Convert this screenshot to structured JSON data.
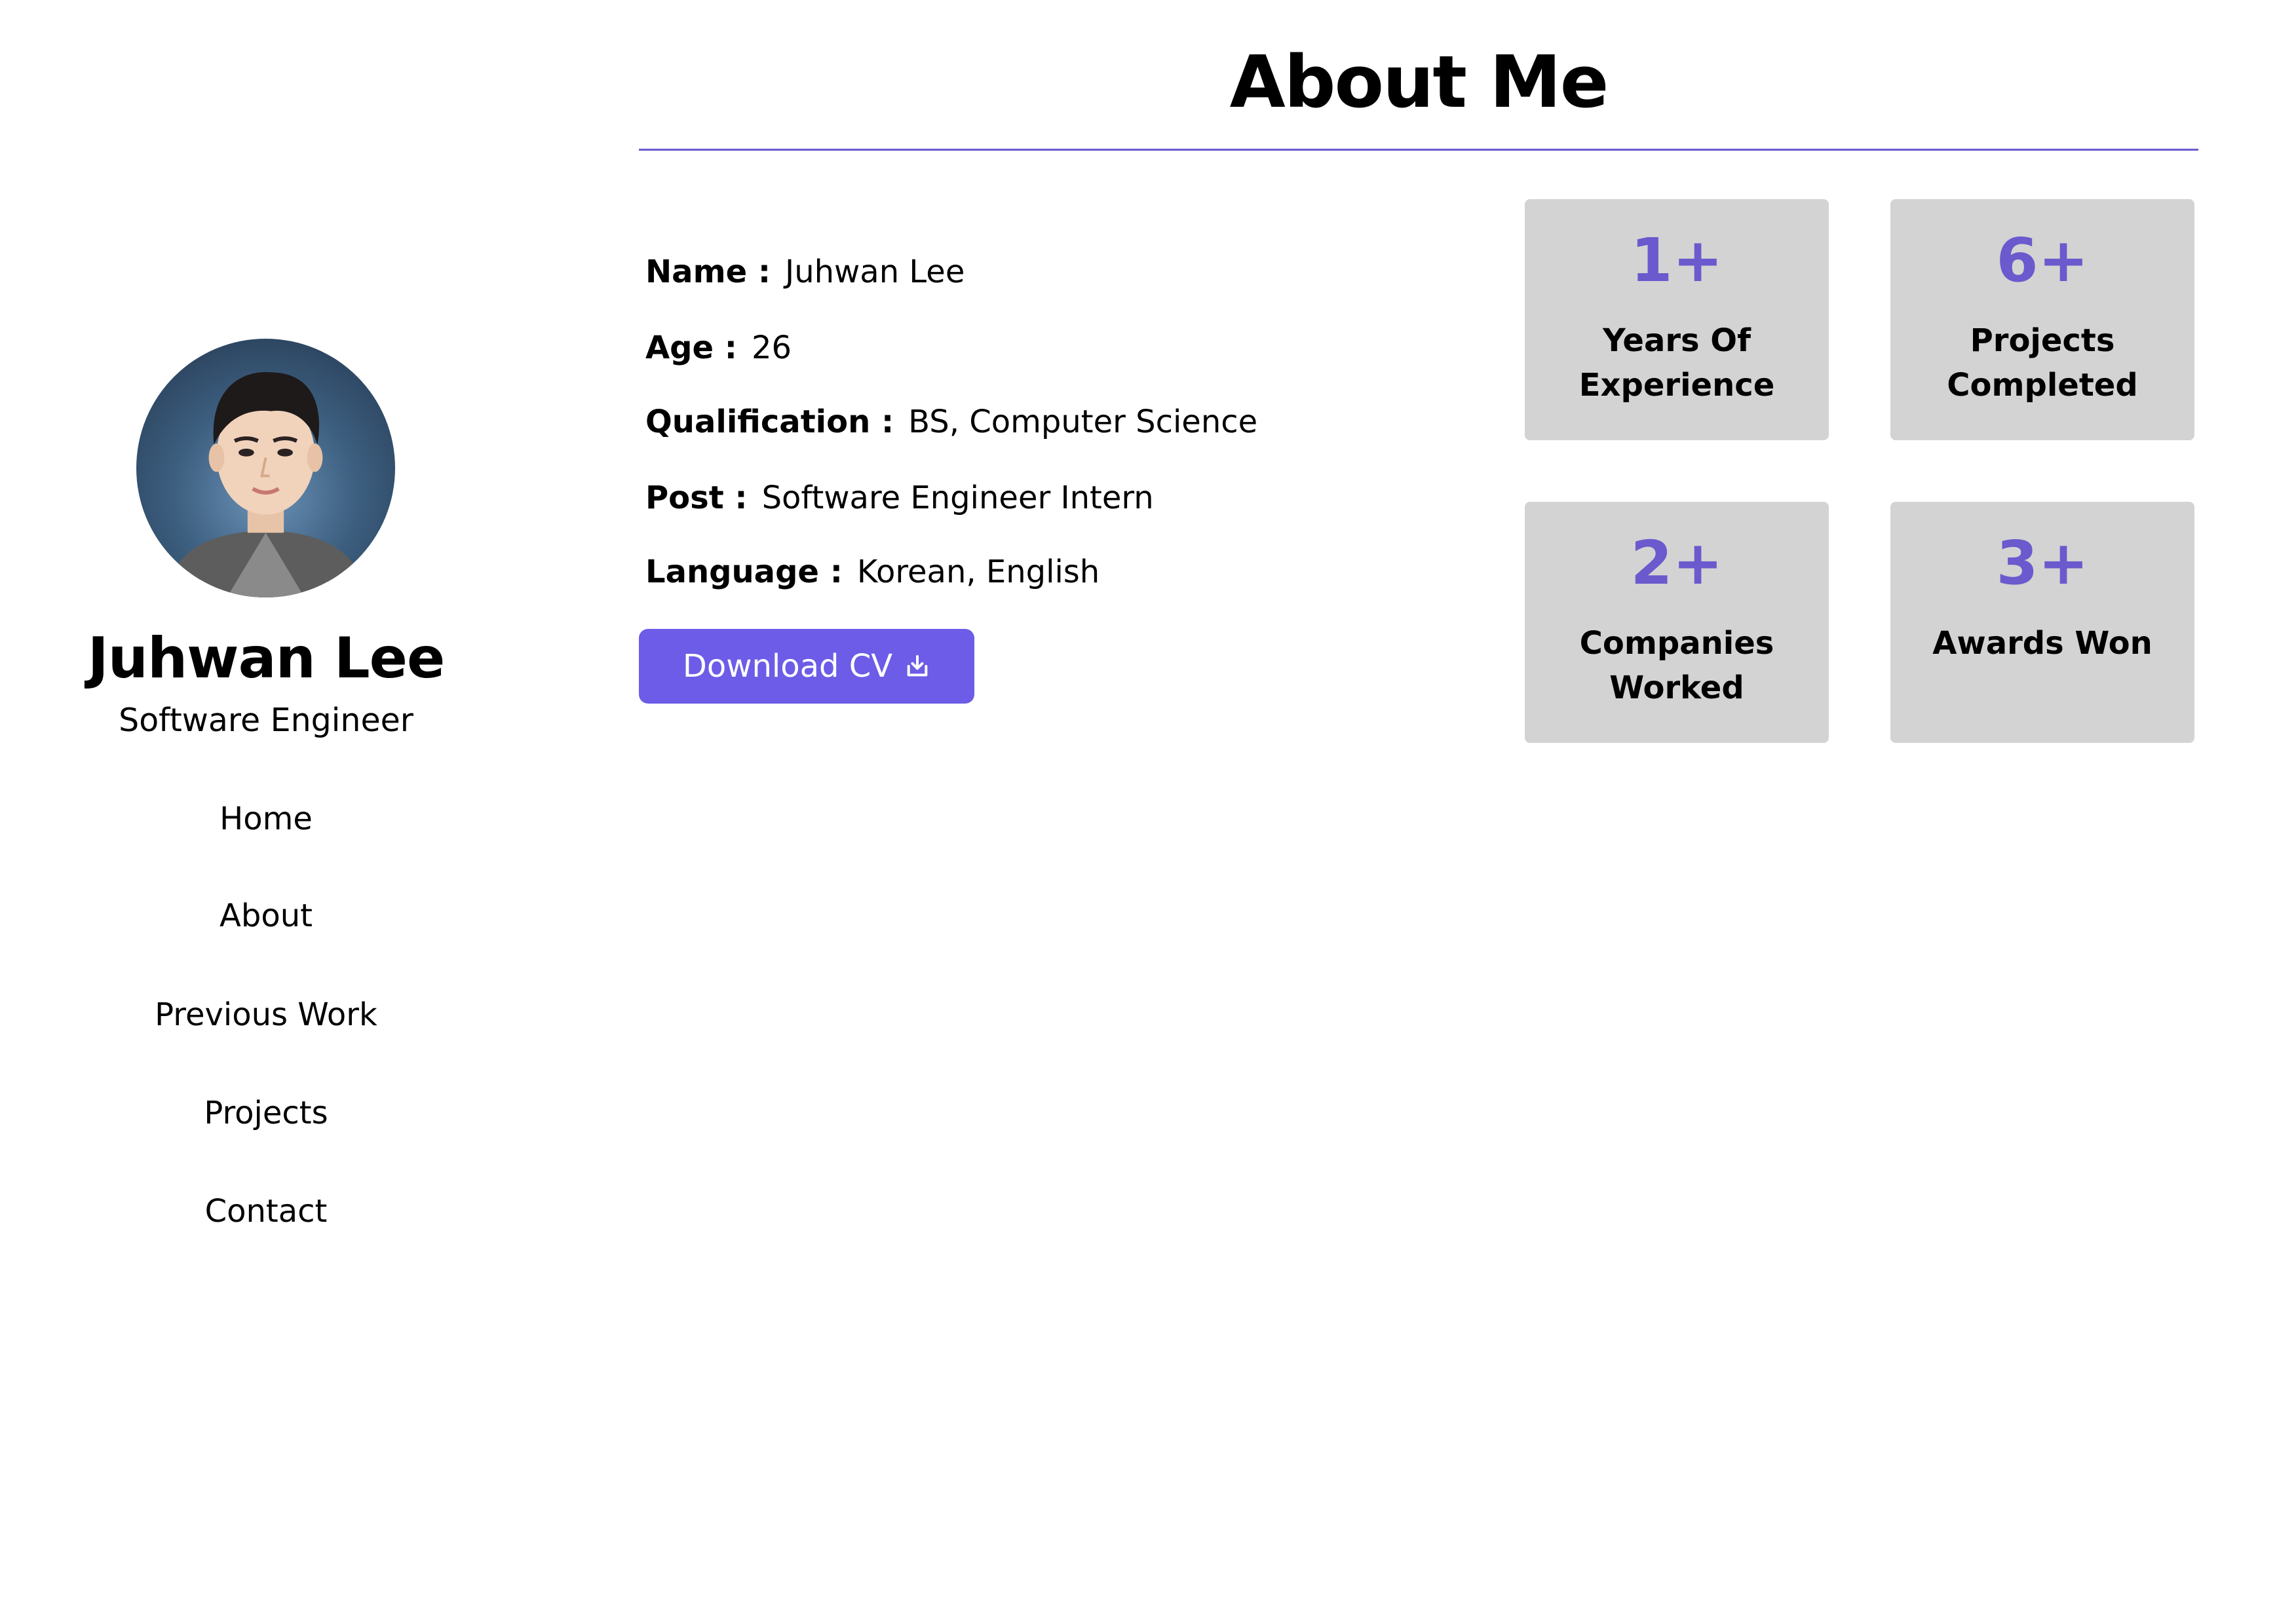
{
  "colors": {
    "accent": "#6c5ce7",
    "accent_text": "#6a5acd",
    "card_background": "#d3d3d3",
    "text": "#000000",
    "background": "#ffffff"
  },
  "profile": {
    "avatar": "profile-photo",
    "name": "Juhwan Lee",
    "role": "Software Engineer"
  },
  "nav": {
    "items": [
      {
        "label": "Home"
      },
      {
        "label": "About"
      },
      {
        "label": "Previous Work"
      },
      {
        "label": "Projects"
      },
      {
        "label": "Contact"
      }
    ]
  },
  "about": {
    "title": "About Me",
    "info": [
      {
        "label": "Name :",
        "value": "Juhwan Lee"
      },
      {
        "label": "Age :",
        "value": "26"
      },
      {
        "label": "Qualification :",
        "value": "BS, Computer Science"
      },
      {
        "label": "Post :",
        "value": "Software Engineer Intern"
      },
      {
        "label": "Language :",
        "value": "Korean, English"
      }
    ],
    "download_button": {
      "label": "Download CV",
      "icon": "download-icon"
    }
  },
  "stats": [
    {
      "value": "1+",
      "label": "Years Of Experience"
    },
    {
      "value": "6+",
      "label": "Projects Completed"
    },
    {
      "value": "2+",
      "label": "Companies Worked"
    },
    {
      "value": "3+",
      "label": "Awards Won"
    }
  ]
}
